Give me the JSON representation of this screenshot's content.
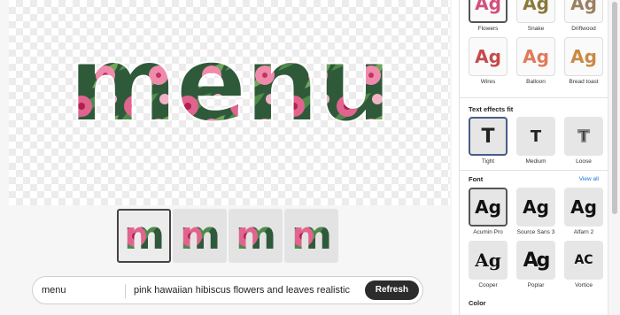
{
  "canvas": {
    "artwork_text": "menu"
  },
  "variations": [
    {
      "label": "m"
    },
    {
      "label": "m"
    },
    {
      "label": "m"
    },
    {
      "label": "m"
    }
  ],
  "prompt_bar": {
    "text_value": "menu",
    "prompt_value": "pink hawaiian hibiscus flowers and leaves realistic",
    "refresh_label": "Refresh"
  },
  "panel": {
    "styles": [
      {
        "label": "Flowers",
        "glyph": "Ag",
        "color": "#d2507a"
      },
      {
        "label": "Snake",
        "glyph": "Ag",
        "color": "#8a7a3a"
      },
      {
        "label": "Driftwood",
        "glyph": "Ag",
        "color": "#9a8062"
      },
      {
        "label": "Wires",
        "glyph": "Ag",
        "color": "#c74a4a"
      },
      {
        "label": "Balloon",
        "glyph": "Ag",
        "color": "#e07a5a"
      },
      {
        "label": "Bread toast",
        "glyph": "Ag",
        "color": "#c98a44"
      }
    ],
    "fit_title": "Text effects fit",
    "fit_options": [
      {
        "label": "Tight",
        "glyph": "T"
      },
      {
        "label": "Medium",
        "glyph": "T"
      },
      {
        "label": "Loose",
        "glyph": "T"
      }
    ],
    "font_title": "Font",
    "view_all": "View all",
    "fonts": [
      {
        "label": "Acumin Pro",
        "glyph": "Ag"
      },
      {
        "label": "Source Sans 3",
        "glyph": "Ag"
      },
      {
        "label": "Alfarn 2",
        "glyph": "Ag"
      },
      {
        "label": "Cooper",
        "glyph": "Ag"
      },
      {
        "label": "Poplar",
        "glyph": "Ag"
      },
      {
        "label": "Vortice",
        "glyph": "AC"
      }
    ],
    "color_title": "Color"
  }
}
